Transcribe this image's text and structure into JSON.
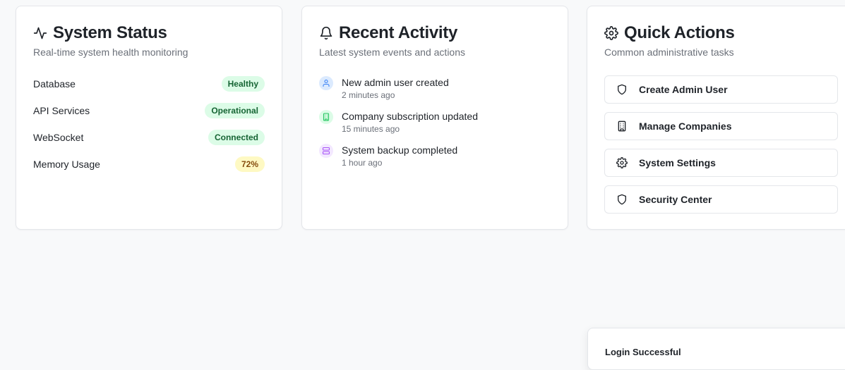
{
  "system_status": {
    "title": "System Status",
    "subtitle": "Real-time system health monitoring",
    "icon": "activity-icon",
    "items": [
      {
        "label": "Database",
        "value": "Healthy",
        "tone": "green"
      },
      {
        "label": "API Services",
        "value": "Operational",
        "tone": "green"
      },
      {
        "label": "WebSocket",
        "value": "Connected",
        "tone": "green"
      },
      {
        "label": "Memory Usage",
        "value": "72%",
        "tone": "yellow"
      }
    ]
  },
  "recent_activity": {
    "title": "Recent Activity",
    "subtitle": "Latest system events and actions",
    "icon": "bell-icon",
    "items": [
      {
        "text": "New admin user created",
        "time": "2 minutes ago",
        "icon": "user-icon",
        "color": "#3b82f6",
        "bg": "#dbeafe"
      },
      {
        "text": "Company subscription updated",
        "time": "15 minutes ago",
        "icon": "building-icon",
        "color": "#22c55e",
        "bg": "#dcfce7"
      },
      {
        "text": "System backup completed",
        "time": "1 hour ago",
        "icon": "server-icon",
        "color": "#a855f7",
        "bg": "#f3e8ff"
      }
    ]
  },
  "quick_actions": {
    "title": "Quick Actions",
    "subtitle": "Common administrative tasks",
    "icon": "gear-icon",
    "buttons": [
      {
        "label": "Create Admin User",
        "icon": "shield-icon"
      },
      {
        "label": "Manage Companies",
        "icon": "building-icon"
      },
      {
        "label": "System Settings",
        "icon": "gear-icon"
      },
      {
        "label": "Security Center",
        "icon": "shield-icon"
      }
    ]
  },
  "toast": {
    "title": "Login Successful"
  },
  "colors": {
    "badge_green_bg": "#dcfce7",
    "badge_green_text": "#166534",
    "badge_yellow_bg": "#fef9c3",
    "badge_yellow_text": "#854d0e"
  }
}
